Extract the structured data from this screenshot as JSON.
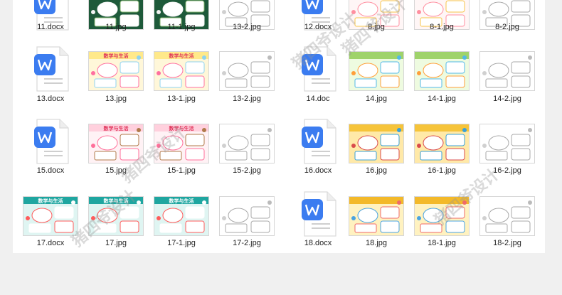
{
  "files": [
    {
      "name": "11.docx",
      "kind": "docx",
      "style": "dark"
    },
    {
      "name": "11.jpg",
      "kind": "jpg",
      "style": "dark"
    },
    {
      "name": "11-1.jpg",
      "kind": "jpg",
      "style": "dark"
    },
    {
      "name": "13-2.jpg",
      "kind": "jpg",
      "style": "outline"
    },
    {
      "name": "12.docx",
      "kind": "docx",
      "style": "plain"
    },
    {
      "name": "8.jpg",
      "kind": "jpg",
      "style": "pink"
    },
    {
      "name": "8-1.jpg",
      "kind": "jpg",
      "style": "pink"
    },
    {
      "name": "8-2.jpg",
      "kind": "jpg",
      "style": "outline"
    },
    {
      "name": "13.docx",
      "kind": "docx",
      "style": "plain"
    },
    {
      "name": "13.jpg",
      "kind": "jpg",
      "style": "yellow",
      "heading": "数学与生活"
    },
    {
      "name": "13-1.jpg",
      "kind": "jpg",
      "style": "yellow",
      "heading": "数学与生活"
    },
    {
      "name": "13-2.jpg",
      "kind": "jpg",
      "style": "outline"
    },
    {
      "name": "14.doc",
      "kind": "docx",
      "style": "plain"
    },
    {
      "name": "14.jpg",
      "kind": "jpg",
      "style": "green"
    },
    {
      "name": "14-1.jpg",
      "kind": "jpg",
      "style": "green"
    },
    {
      "name": "14-2.jpg",
      "kind": "jpg",
      "style": "outline"
    },
    {
      "name": "15.docx",
      "kind": "docx",
      "style": "plain"
    },
    {
      "name": "15.jpg",
      "kind": "jpg",
      "style": "pinkbrown",
      "heading": "数学与生活"
    },
    {
      "name": "15-1.jpg",
      "kind": "jpg",
      "style": "pinkbrown",
      "heading": "数学与生活"
    },
    {
      "name": "15-2.jpg",
      "kind": "jpg",
      "style": "outline"
    },
    {
      "name": "16.docx",
      "kind": "docx",
      "style": "plain"
    },
    {
      "name": "16.jpg",
      "kind": "jpg",
      "style": "gold"
    },
    {
      "name": "16-1.jpg",
      "kind": "jpg",
      "style": "gold"
    },
    {
      "name": "16-2.jpg",
      "kind": "jpg",
      "style": "outline"
    },
    {
      "name": "17.docx",
      "kind": "jpg",
      "style": "teal",
      "heading": "数学与生活"
    },
    {
      "name": "17.jpg",
      "kind": "jpg",
      "style": "teal",
      "heading": "数学与生活"
    },
    {
      "name": "17-1.jpg",
      "kind": "jpg",
      "style": "teal",
      "heading": "数学与生活"
    },
    {
      "name": "17-2.jpg",
      "kind": "jpg",
      "style": "outline"
    },
    {
      "name": "18.docx",
      "kind": "docx",
      "style": "plain"
    },
    {
      "name": "18.jpg",
      "kind": "jpg",
      "style": "gold2"
    },
    {
      "name": "18-1.jpg",
      "kind": "jpg",
      "style": "gold2"
    },
    {
      "name": "18-2.jpg",
      "kind": "jpg",
      "style": "outline"
    }
  ],
  "watermark": "猪四爷设计",
  "colors": {
    "word_blue": "#3b7cf0",
    "label_text": "#1f1f1f"
  }
}
